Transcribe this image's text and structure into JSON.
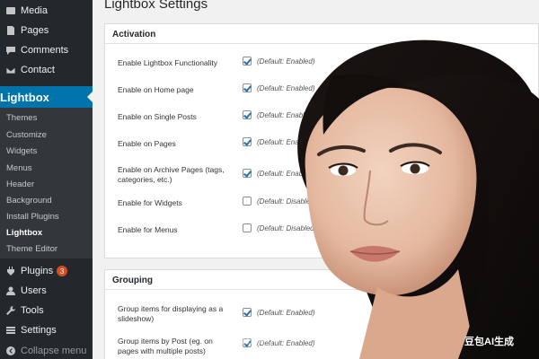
{
  "sidebar": {
    "items": [
      {
        "label": "Media",
        "icon": "media-icon"
      },
      {
        "label": "Pages",
        "icon": "pages-icon"
      },
      {
        "label": "Comments",
        "icon": "comments-icon"
      },
      {
        "label": "Contact",
        "icon": "mail-icon"
      }
    ],
    "active": {
      "label": "Lightbox",
      "icon": "brush-icon"
    },
    "submenu": [
      "Themes",
      "Customize",
      "Widgets",
      "Menus",
      "Header",
      "Background",
      "Install Plugins",
      "Lightbox",
      "Theme Editor"
    ],
    "lower": [
      {
        "label": "Plugins",
        "icon": "plugin-icon",
        "badge": "3"
      },
      {
        "label": "Users",
        "icon": "users-icon"
      },
      {
        "label": "Tools",
        "icon": "wrench-icon"
      },
      {
        "label": "Settings",
        "icon": "settings-icon"
      },
      {
        "label": "Collapse menu",
        "icon": "collapse-icon"
      }
    ]
  },
  "page": {
    "title": "Lightbox Settings"
  },
  "activation": {
    "heading": "Activation",
    "rows": [
      {
        "label": "Enable Lightbox Functionality",
        "checked": true,
        "default": "(Default: Enabled)"
      },
      {
        "label": "Enable on Home page",
        "checked": true,
        "default": "(Default: Enabled)"
      },
      {
        "label": "Enable on Single Posts",
        "checked": true,
        "default": "(Default: Enabled)"
      },
      {
        "label": "Enable on Pages",
        "checked": true,
        "default": "(Default: Enabled)"
      },
      {
        "label": "Enable on Archive Pages (tags, categories, etc.)",
        "checked": true,
        "default": "(Default: Enabled)"
      },
      {
        "label": "Enable for Widgets",
        "checked": false,
        "default": "(Default: Disabled)"
      },
      {
        "label": "Enable for Menus",
        "checked": false,
        "default": "(Default: Disabled)"
      }
    ]
  },
  "grouping": {
    "heading": "Grouping",
    "rows": [
      {
        "label": "Group items for displaying as a slideshow)",
        "checked": true,
        "default": "(Default: Enabled)"
      },
      {
        "label": "Group items by Post (eg. on pages with multiple posts)",
        "checked": true,
        "default": "(Default: Enabled)"
      }
    ]
  },
  "overlay": {
    "watermark": "a stock watermark",
    "ai_mark": "豆包AI生成"
  },
  "colors": {
    "sidebar": "#23282d",
    "active": "#0073aa",
    "submenu": "#32373c",
    "check": "#2271b1",
    "badge": "#d54e21"
  }
}
